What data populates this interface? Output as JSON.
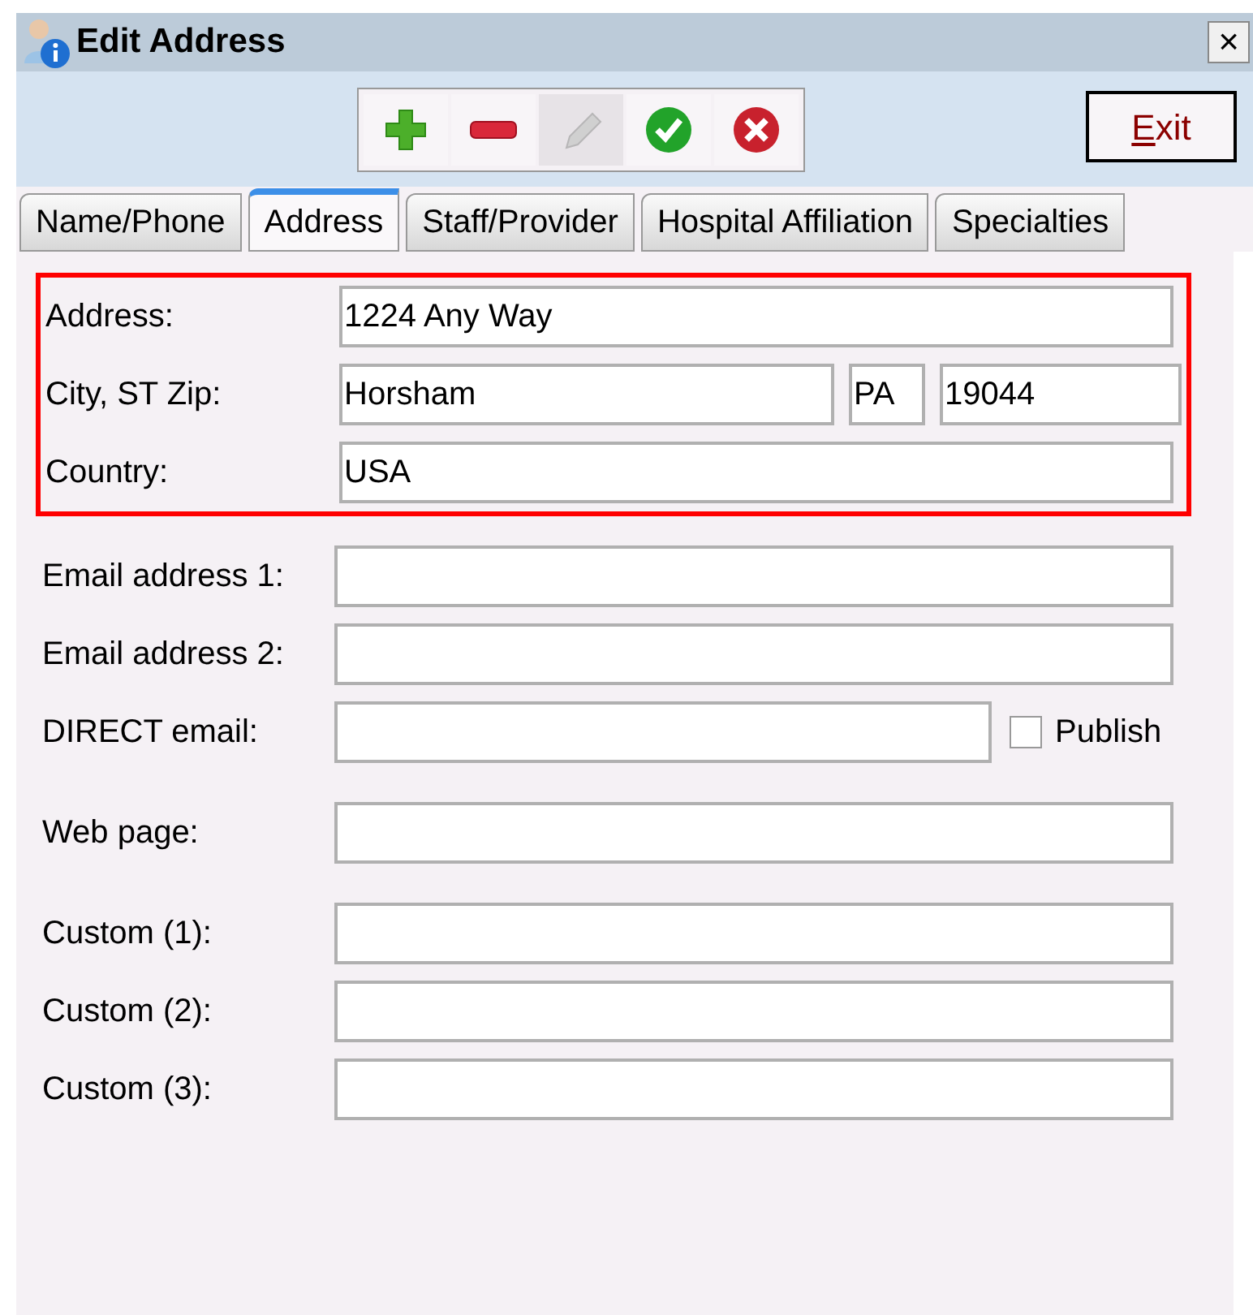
{
  "window": {
    "title": "Edit Address",
    "close": "×"
  },
  "toolbar": {
    "buttons": [
      {
        "kind": "add",
        "disabled": false
      },
      {
        "kind": "remove",
        "disabled": false
      },
      {
        "kind": "edit",
        "disabled": true
      },
      {
        "kind": "ok",
        "disabled": false
      },
      {
        "kind": "cancel",
        "disabled": false
      }
    ],
    "exit": "Exit"
  },
  "tabs": [
    {
      "label": "Name/Phone",
      "selected": false
    },
    {
      "label": "Address",
      "selected": true
    },
    {
      "label": "Staff/Provider",
      "selected": false
    },
    {
      "label": "Hospital Affiliation",
      "selected": false
    },
    {
      "label": "Specialties",
      "selected": false
    }
  ],
  "address_group": {
    "highlighted": true,
    "rows": [
      {
        "label": "Address:",
        "fields": [
          {
            "value": "1224 Any Way"
          }
        ]
      },
      {
        "label": "City, ST Zip:",
        "fields": [
          {
            "value": "Horsham"
          },
          {
            "value": "PA"
          },
          {
            "value": "19044"
          }
        ]
      },
      {
        "label": "Country:",
        "fields": [
          {
            "value": "USA"
          }
        ]
      }
    ]
  },
  "sections": [
    [
      {
        "label": "Email address 1:",
        "kind": "text"
      },
      {
        "label": "Email address 2:",
        "kind": "text"
      },
      {
        "label": "DIRECT email:",
        "kind": "publish",
        "publish": {
          "label": "Publish",
          "checked": false
        }
      }
    ],
    [
      {
        "label": "Web page:",
        "kind": "text"
      }
    ],
    [
      {
        "label": "Custom (1):",
        "kind": "text"
      },
      {
        "label": "Custom (2):",
        "kind": "text"
      },
      {
        "label": "Custom (3):",
        "kind": "text"
      }
    ]
  ]
}
